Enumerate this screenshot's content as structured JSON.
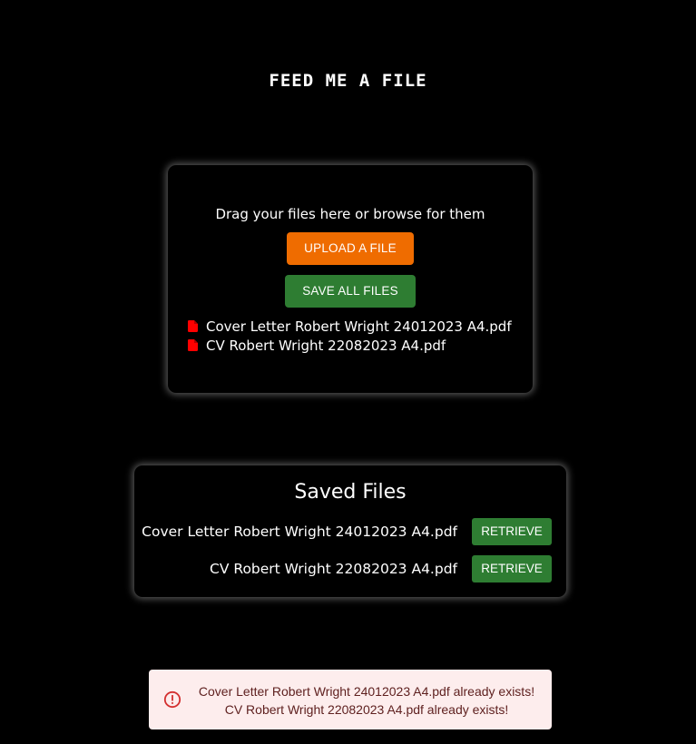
{
  "header": {
    "title": "FEED ME A FILE"
  },
  "upload": {
    "drag_text": "Drag your files here or browse for them",
    "upload_label": "UPLOAD A FILE",
    "save_all_label": "SAVE ALL FILES",
    "files": [
      {
        "name": "Cover Letter Robert Wright 24012023 A4.pdf",
        "icon": "pdf-file-icon"
      },
      {
        "name": "CV Robert Wright 22082023 A4.pdf",
        "icon": "pdf-file-icon"
      }
    ]
  },
  "saved": {
    "title": "Saved Files",
    "items": [
      {
        "name": "Cover Letter Robert Wright 24012023 A4.pdf",
        "action": "RETRIEVE"
      },
      {
        "name": "CV Robert Wright 22082023 A4.pdf",
        "action": "RETRIEVE"
      }
    ]
  },
  "alert": {
    "icon": "error-outline-icon",
    "messages": [
      "Cover Letter Robert Wright 24012023 A4.pdf already exists!",
      "CV Robert Wright 22082023 A4.pdf already exists!"
    ]
  },
  "colors": {
    "background": "#000000",
    "upload_button": "#ef6c00",
    "save_button": "#2e7d32",
    "retrieve_button": "#2e7d32",
    "pdf_icon": "#ff0000",
    "alert_background": "#fdeded",
    "alert_text": "#5f2120",
    "alert_icon": "#d32f2f"
  }
}
